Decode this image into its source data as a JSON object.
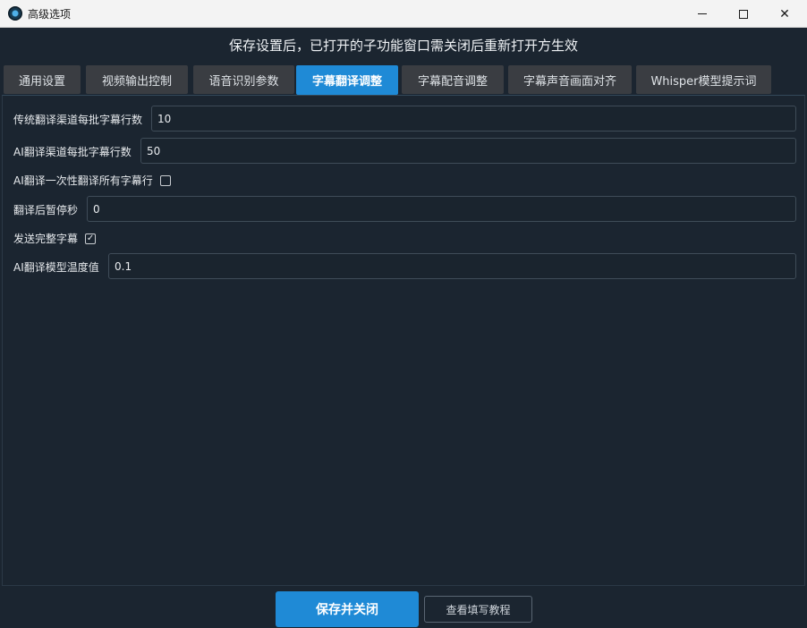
{
  "window": {
    "title": "高级选项",
    "icon": "app-logo-icon",
    "controls": [
      "minimize-icon",
      "maximize-icon",
      "close-icon"
    ]
  },
  "notice": "保存设置后，已打开的子功能窗口需关闭后重新打开方生效",
  "tabs": [
    {
      "label": "通用设置",
      "active": false
    },
    {
      "label": "视频输出控制",
      "active": false
    },
    {
      "label": "语音识别参数",
      "active": false
    },
    {
      "label": "字幕翻译调整",
      "active": true
    },
    {
      "label": "字幕配音调整",
      "active": false
    },
    {
      "label": "字幕声音画面对齐",
      "active": false
    },
    {
      "label": "Whisper模型提示词",
      "active": false
    }
  ],
  "settings": {
    "trad_batch_label": "传统翻译渠道每批字幕行数",
    "trad_batch_value": "10",
    "ai_batch_label": "AI翻译渠道每批字幕行数",
    "ai_batch_value": "50",
    "ai_all_label": "AI翻译一次性翻译所有字幕行",
    "ai_all_checked": false,
    "pause_label": "翻译后暂停秒",
    "pause_value": "0",
    "send_full_label": "发送完整字幕",
    "send_full_checked": true,
    "temperature_label": "AI翻译模型温度值",
    "temperature_value": "0.1"
  },
  "footer": {
    "save_label": "保存并关闭",
    "tutorial_label": "查看填写教程"
  },
  "colors": {
    "background": "#1b2530",
    "accent": "#1f8ad6",
    "tab_inactive": "#3a3d42"
  }
}
